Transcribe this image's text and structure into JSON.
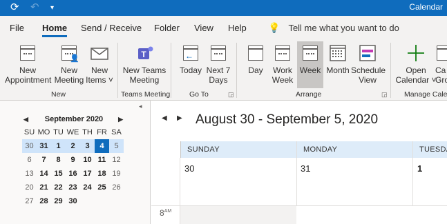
{
  "titlebar": {
    "title": "Calendar",
    "sync_icon": "sync-icon",
    "undo_icon": "undo-icon",
    "qat_icon": "customize-toolbar-icon"
  },
  "menu": {
    "tabs": [
      "File",
      "Home",
      "Send / Receive",
      "Folder",
      "View",
      "Help"
    ],
    "active": "Home",
    "tell_me": "Tell me what you want to do"
  },
  "ribbon": {
    "new": {
      "label": "New",
      "new_appointment": [
        "New",
        "Appointment"
      ],
      "new_meeting": [
        "New",
        "Meeting"
      ],
      "new_items": [
        "New",
        "Items ˅"
      ]
    },
    "teams": {
      "label": "Teams Meeting",
      "button": [
        "New Teams",
        "Meeting"
      ]
    },
    "goto": {
      "label": "Go To",
      "today": "Today",
      "next7": [
        "Next 7",
        "Days"
      ]
    },
    "arrange": {
      "label": "Arrange",
      "day": "Day",
      "work_week": [
        "Work",
        "Week"
      ],
      "week": "Week",
      "month": "Month",
      "schedule": [
        "Schedule",
        "View"
      ]
    },
    "manage": {
      "label": "Manage Calen",
      "open_calendar": [
        "Open",
        "Calendar ˅"
      ],
      "calendar_groups": [
        "Ca",
        "Gro"
      ]
    }
  },
  "mini_calendar": {
    "month": "September 2020",
    "day_headers": [
      "SU",
      "MO",
      "TU",
      "WE",
      "TH",
      "FR",
      "SA"
    ],
    "weeks": [
      [
        "30",
        "31",
        "1",
        "2",
        "3",
        "4",
        "5"
      ],
      [
        "6",
        "7",
        "8",
        "9",
        "10",
        "11",
        "12"
      ],
      [
        "13",
        "14",
        "15",
        "16",
        "17",
        "18",
        "19"
      ],
      [
        "20",
        "21",
        "22",
        "23",
        "24",
        "25",
        "26"
      ],
      [
        "27",
        "28",
        "29",
        "30",
        "",
        "",
        ""
      ]
    ],
    "selected_week_index": 0,
    "today": "4"
  },
  "calendar_view": {
    "range": "August 30 - September 5, 2020",
    "days": [
      {
        "name": "SUNDAY",
        "num": "30"
      },
      {
        "name": "MONDAY",
        "num": "31"
      },
      {
        "name": "TUESDA",
        "num": "1"
      }
    ],
    "time_label": "8",
    "time_suffix": "AM"
  }
}
